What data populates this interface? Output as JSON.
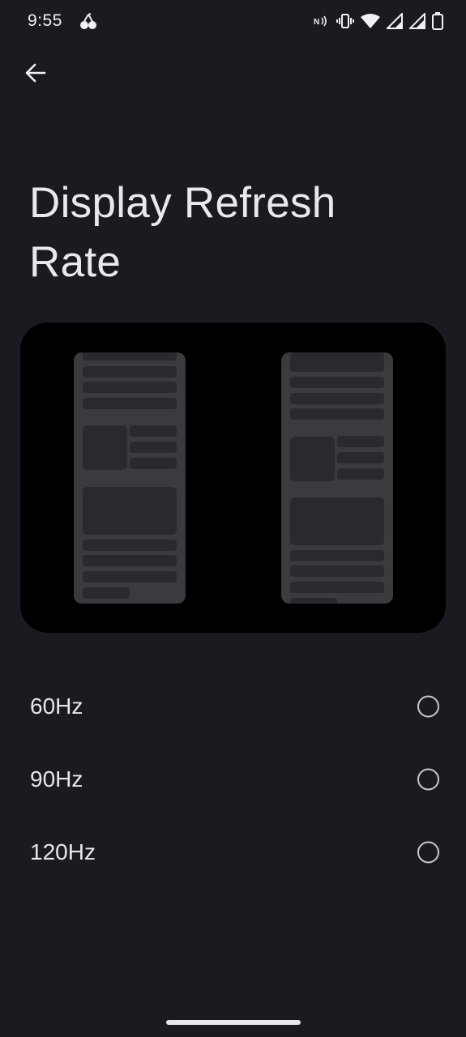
{
  "status_bar": {
    "time": "9:55",
    "app_icon": "cherry-icon",
    "icons": [
      "nfc-icon",
      "vibrate-icon",
      "wifi-icon",
      "signal-icon",
      "signal-icon-2",
      "battery-icon"
    ]
  },
  "header": {
    "back_icon": "arrow-back-icon",
    "title": "Display Refresh Rate"
  },
  "illustration": {
    "description_icon": "refresh-rate-illustration"
  },
  "options": [
    {
      "label": "60Hz",
      "selected": false
    },
    {
      "label": "90Hz",
      "selected": false
    },
    {
      "label": "120Hz",
      "selected": false
    }
  ],
  "colors": {
    "background": "#1a1b21",
    "text": "#e6e6ec",
    "illustration_bg": "#000000",
    "phone_body": "#3a3a3f",
    "phone_bar": "#2a2a2e"
  }
}
